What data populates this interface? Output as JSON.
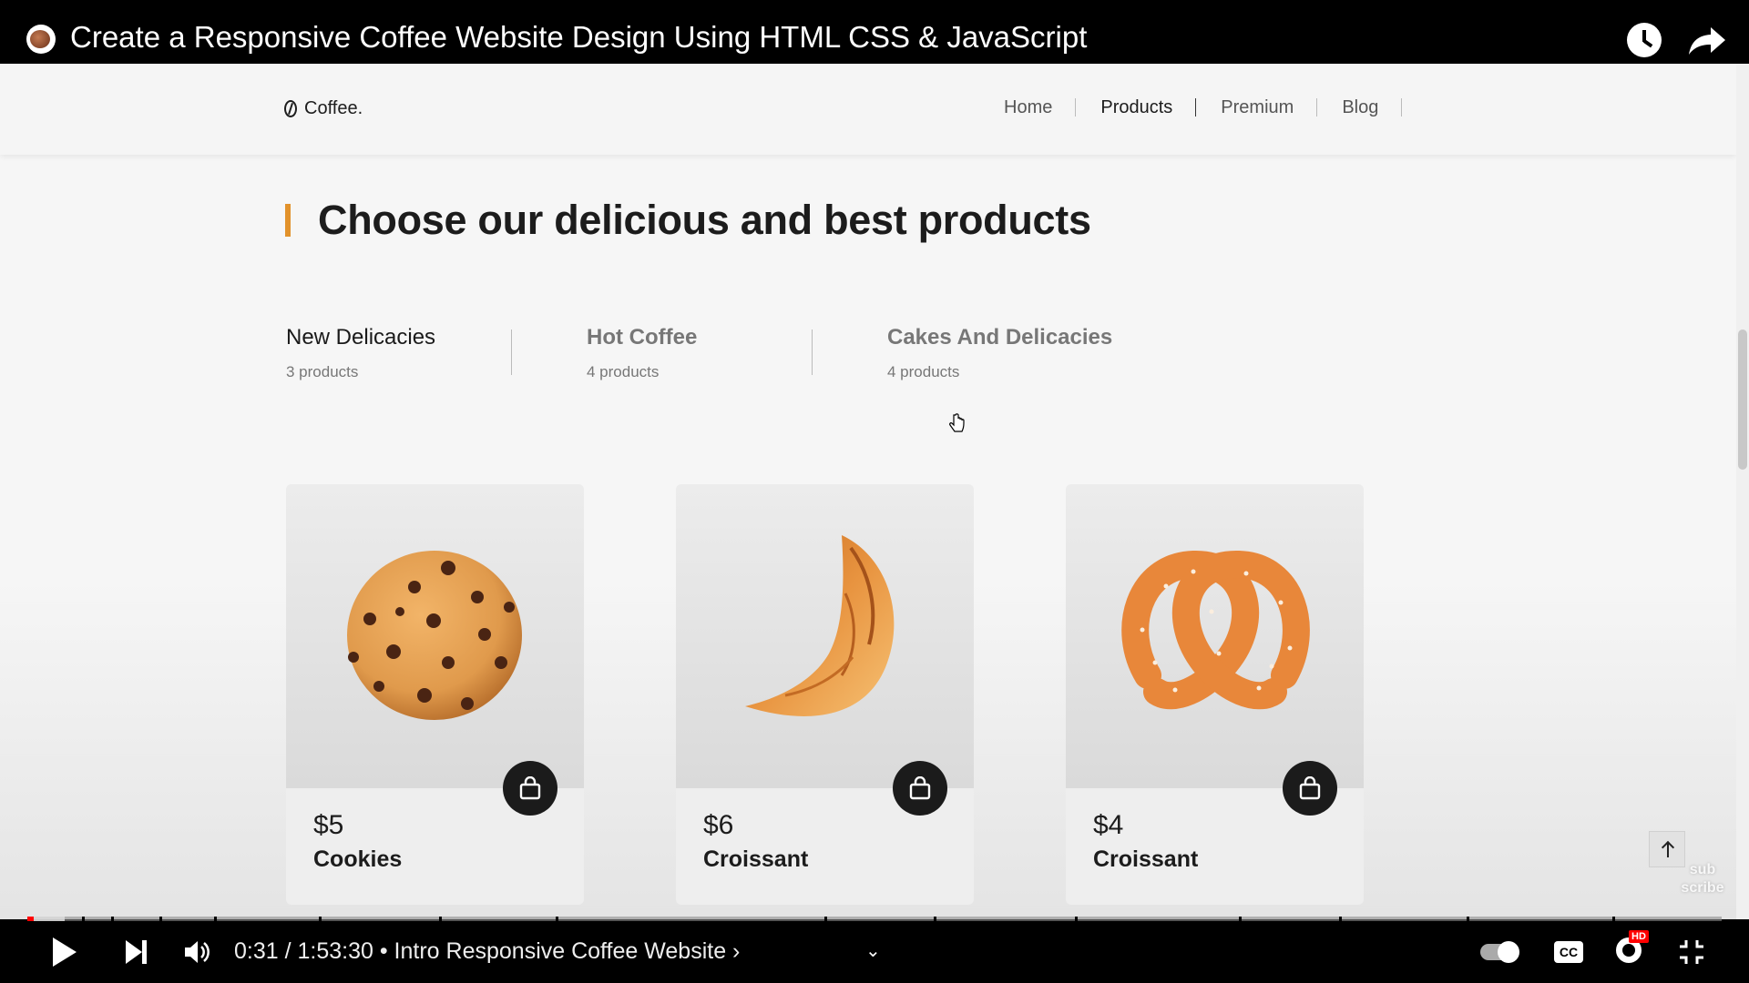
{
  "player": {
    "video_title": "Create a Responsive Coffee Website Design Using HTML CSS & JavaScript",
    "time_display": "0:31 / 1:53:30 • Intro Responsive Coffee Website ›",
    "progress_fraction": 0.004,
    "buffered_fraction": 0.022,
    "hd_badge": "HD",
    "cc_label": "CC",
    "subscribe_watermark_top": "sub",
    "subscribe_watermark_bottom": "scribe"
  },
  "site": {
    "logo_text": "Coffee.",
    "nav": [
      {
        "label": "Home",
        "active": false
      },
      {
        "label": "Products",
        "active": true
      },
      {
        "label": "Premium",
        "active": false
      },
      {
        "label": "Blog",
        "active": false
      }
    ],
    "section_title": "Choose our delicious and best products",
    "tabs": [
      {
        "name": "New Delicacies",
        "count": "3 products",
        "active": true
      },
      {
        "name": "Hot Coffee",
        "count": "4 products",
        "active": false
      },
      {
        "name": "Cakes And Delicacies",
        "count": "4 products",
        "active": false
      }
    ],
    "products": [
      {
        "price": "$5",
        "name": "Cookies",
        "image": "cookie-image"
      },
      {
        "price": "$6",
        "name": "Croissant",
        "image": "croissant-image"
      },
      {
        "price": "$4",
        "name": "Croissant",
        "image": "pretzel-image"
      }
    ]
  },
  "colors": {
    "accent": "#e2922b",
    "player_progress": "#ff0000",
    "cart_button": "#1b1b1b"
  },
  "icons": [
    "channel-avatar-icon",
    "watch-later-icon",
    "share-icon",
    "coffee-bean-logo-icon",
    "shopping-bag-icon",
    "back-to-top-icon",
    "play-icon",
    "next-icon",
    "volume-icon",
    "chevron-down-icon",
    "autoplay-toggle-icon",
    "cc-icon",
    "settings-icon",
    "fullscreen-exit-icon",
    "hand-cursor-icon"
  ]
}
